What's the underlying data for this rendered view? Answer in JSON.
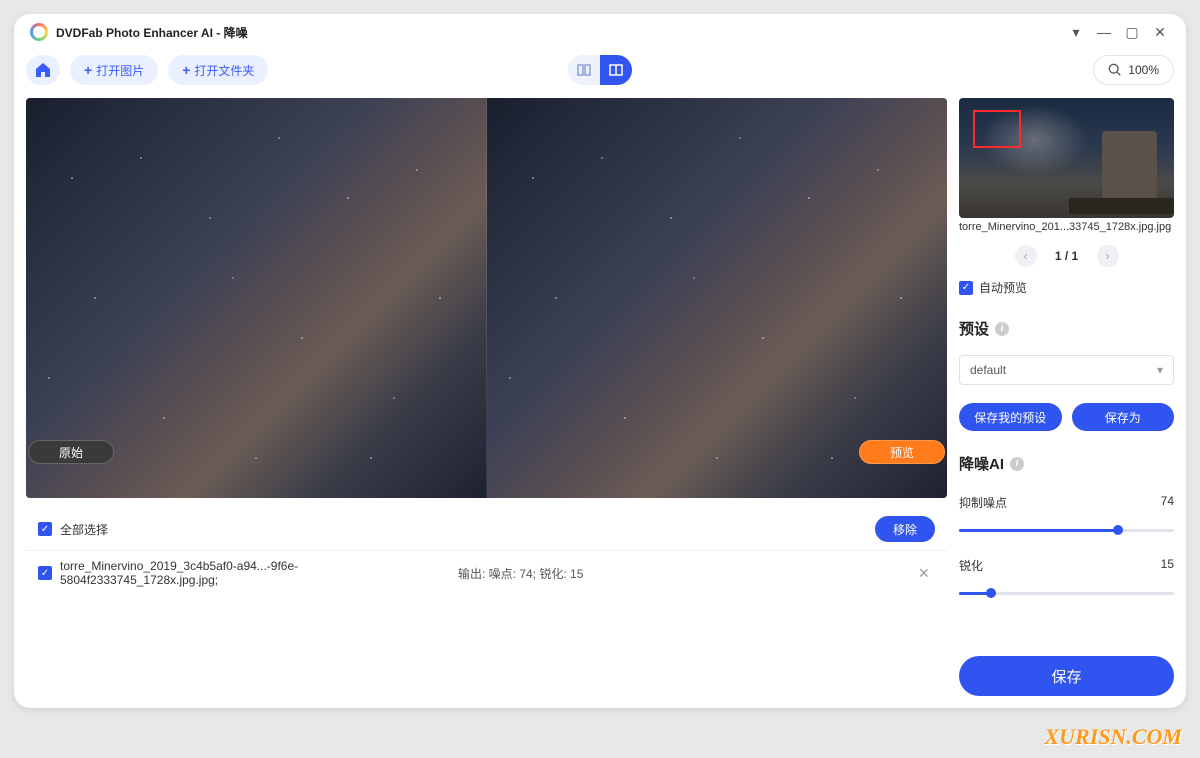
{
  "title": "DVDFab Photo Enhancer AI - 降噪",
  "toolbar": {
    "open_image": "打开图片",
    "open_folder": "打开文件夹",
    "zoom": "100%"
  },
  "preview": {
    "original_label": "原始",
    "preview_label": "预览"
  },
  "file_panel": {
    "select_all": "全部选择",
    "remove": "移除",
    "row": {
      "name": "torre_Minervino_2019_3c4b5af0-a94...-9f6e-5804f2333745_1728x.jpg.jpg;",
      "output": "输出: 噪点: 74; 锐化: 15"
    }
  },
  "sidebar": {
    "thumb_name": "torre_Minervino_201...33745_1728x.jpg.jpg",
    "pager": "1 / 1",
    "auto_preview": "自动预览",
    "preset_title": "预设",
    "preset_value": "default",
    "save_my_preset": "保存我的预设",
    "save_as": "保存为",
    "denoise_title": "降噪AI",
    "noise_label": "抑制噪点",
    "noise_value": "74",
    "noise_pct": 74,
    "sharpen_label": "锐化",
    "sharpen_value": "15",
    "sharpen_pct": 15,
    "save": "保存"
  },
  "watermark": "XURISN.COM"
}
